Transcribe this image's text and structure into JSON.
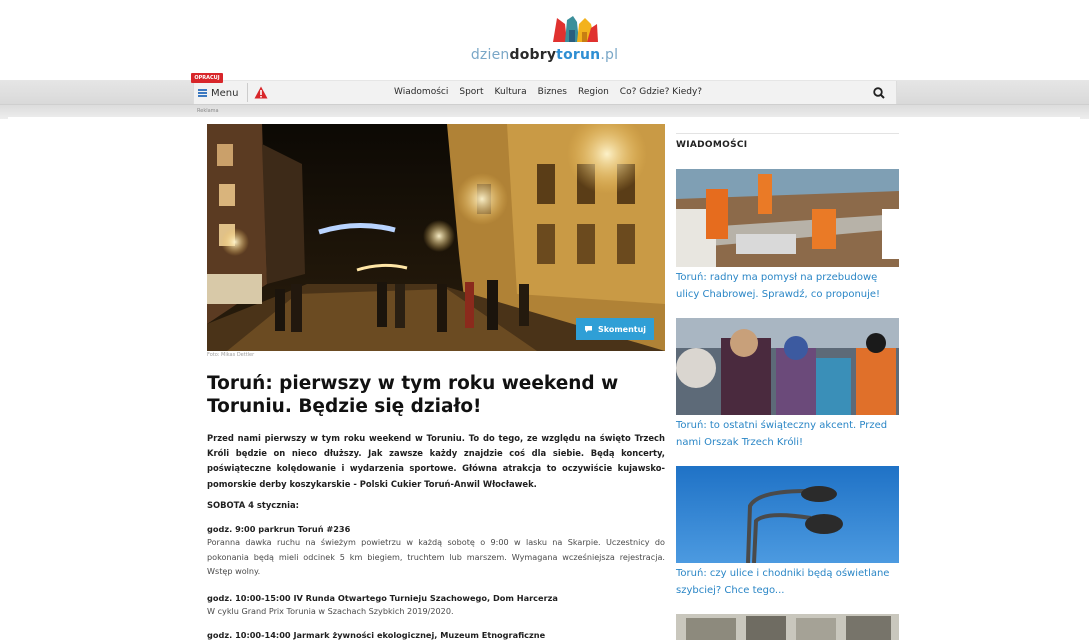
{
  "header": {
    "logo_text_part1": "dzien",
    "logo_text_part2": "dobry",
    "logo_text_part3": "torun",
    "logo_text_part4": ".pl",
    "logo_icon": "colored-castle-towers-logo",
    "brand_colors": {
      "red": "#e0312f",
      "yellow": "#f3b21c",
      "blue": "#2f8fd3",
      "teal": "#3b8f9a"
    }
  },
  "nav": {
    "badge": "OPRACUJ",
    "menu_label": "Menu",
    "menu_icon": "hamburger-icon",
    "alert_icon": "warning-triangle-icon",
    "links": [
      "Wiadomości",
      "Sport",
      "Kultura",
      "Biznes",
      "Region",
      "Co? Gdzie? Kiedy?"
    ],
    "search_icon": "search-icon",
    "sub_label": "Reklama"
  },
  "article": {
    "hero_alt": "night street with Christmas lights",
    "comment_label": "Skomentuj",
    "comment_icon": "speech-bubble-icon",
    "photo_credit": "Foto: Mikas Dettler",
    "title": "Toruń: pierwszy w tym roku weekend w Toruniu. Będzie się działo!",
    "lead": "Przed nami pierwszy w tym roku weekend w Toruniu. To do tego, ze względu na święto Trzech Króli będzie on nieco dłuższy. Jak zawsze każdy znajdzie coś dla siebie. Będą koncerty, poświąteczne kolędowanie i wydarzenia sportowe. Główna atrakcja to oczywiście kujawsko-pomorskie derby koszykarskie - Polski Cukier Toruń-Anwil Włocławek.",
    "day_heading": "SOBOTA 4 stycznia:",
    "events": [
      {
        "title": "godz. 9:00 parkrun Toruń #236",
        "desc": "Poranna dawka ruchu na świeżym powietrzu w każdą sobotę o 9:00 w lasku na Skarpie. Uczestnicy do pokonania będą mieli odcinek 5 km biegiem, truchtem lub marszem. Wymagana wcześniejsza rejestracja. Wstęp wolny."
      },
      {
        "title": "godz. 10:00-15:00 IV Runda Otwartego Turnieju Szachowego, Dom Harcerza",
        "desc": "W cyklu Grand Prix Torunia w Szachach Szybkich 2019/2020."
      },
      {
        "title": "godz. 10:00-14:00 Jarmark żywności ekologicznej, Muzeum Etnograficzne",
        "desc": ""
      }
    ]
  },
  "sidebar": {
    "heading": "WIADOMOŚCI",
    "items": [
      {
        "title": "Toruń: radny ma pomysł na przebudowę ulicy Chabrowej. Sprawdź, co proponuje!",
        "image": "road-workers-photo"
      },
      {
        "title": "Toruń: to ostatni świąteczny akcent. Przed nami Orszak Trzech Króli!",
        "image": "three-kings-procession-photo"
      },
      {
        "title": "Toruń: czy ulice i chodniki będą oświetlane szybciej? Chce tego...",
        "image": "street-lamp-photo"
      },
      {
        "title": "",
        "image": "bus-interior-photo"
      }
    ],
    "accent_color": "#2a86c6"
  }
}
